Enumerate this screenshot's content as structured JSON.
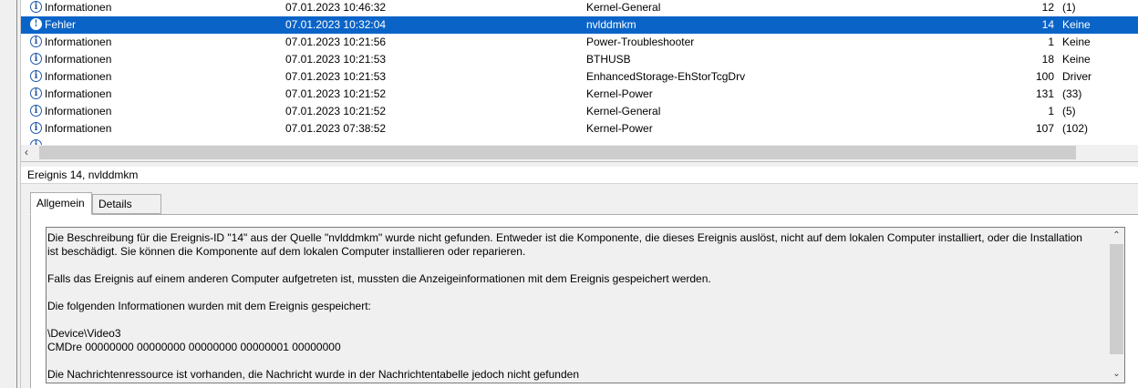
{
  "events": [
    {
      "level": "Informationen",
      "date": "07.01.2023 10:46:32",
      "source": "Kernel-General",
      "id": "12",
      "category": "(1)",
      "type": "info"
    },
    {
      "level": "Fehler",
      "date": "07.01.2023 10:32:04",
      "source": "nvlddmkm",
      "id": "14",
      "category": "Keine",
      "type": "error",
      "selected": true
    },
    {
      "level": "Informationen",
      "date": "07.01.2023 10:21:56",
      "source": "Power-Troubleshooter",
      "id": "1",
      "category": "Keine",
      "type": "info"
    },
    {
      "level": "Informationen",
      "date": "07.01.2023 10:21:53",
      "source": "BTHUSB",
      "id": "18",
      "category": "Keine",
      "type": "info"
    },
    {
      "level": "Informationen",
      "date": "07.01.2023 10:21:53",
      "source": "EnhancedStorage-EhStorTcgDrv",
      "id": "100",
      "category": "Driver",
      "type": "info"
    },
    {
      "level": "Informationen",
      "date": "07.01.2023 10:21:52",
      "source": "Kernel-Power",
      "id": "131",
      "category": "(33)",
      "type": "info"
    },
    {
      "level": "Informationen",
      "date": "07.01.2023 10:21:52",
      "source": "Kernel-General",
      "id": "1",
      "category": "(5)",
      "type": "info"
    },
    {
      "level": "Informationen",
      "date": "07.01.2023 07:38:52",
      "source": "Kernel-Power",
      "id": "107",
      "category": "(102)",
      "type": "info"
    }
  ],
  "event_header": "Ereignis 14, nvlddmkm",
  "tabs": {
    "general": "Allgemein",
    "details": "Details"
  },
  "description": {
    "p1": "Die Beschreibung für die Ereignis-ID \"14\" aus der Quelle \"nvlddmkm\" wurde nicht gefunden. Entweder ist die Komponente, die dieses Ereignis auslöst, nicht auf dem lokalen Computer installiert, oder die Installation ist beschädigt. Sie können die Komponente auf dem lokalen Computer installieren oder reparieren.",
    "p2": "Falls das Ereignis auf einem anderen Computer aufgetreten ist, mussten die Anzeigeinformationen mit dem Ereignis gespeichert werden.",
    "p3": "Die folgenden Informationen wurden mit dem Ereignis gespeichert:",
    "p4": "\\Device\\Video3",
    "p5": "CMDre 00000000 00000000 00000000 00000001 00000000",
    "p6": "Die Nachrichtenressource ist vorhanden, die Nachricht wurde in der Nachrichtentabelle jedoch nicht gefunden"
  },
  "icons": {
    "info": "info-icon",
    "error": "error-icon"
  },
  "colors": {
    "selection": "#0a64c8"
  }
}
